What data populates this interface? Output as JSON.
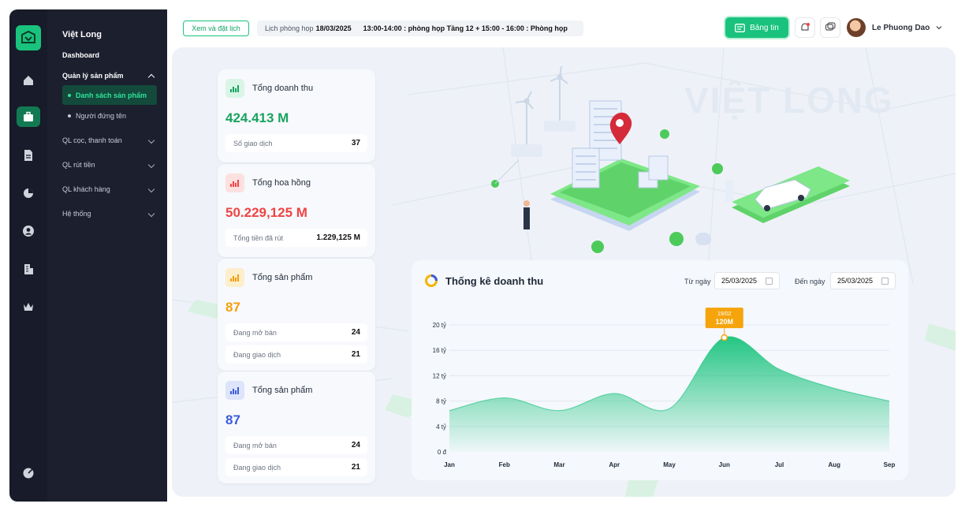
{
  "app": {
    "name": "Việt Long"
  },
  "sidebar": {
    "brand": "Việt Long",
    "dashboard": "Dashboard",
    "group_open": "Quản lý sản phẩm",
    "sub_active": "Danh sách sản phẩm",
    "sub_other": "Người đứng tên",
    "items": [
      "QL cọc, thanh toán",
      "QL rút tiền",
      "QL khách hàng",
      "Hệ thống"
    ]
  },
  "rail_icons": [
    "home-icon",
    "briefcase-icon",
    "document-icon",
    "pie-chart-icon",
    "user-icon",
    "building-icon",
    "crown-icon",
    "settings-chart-icon"
  ],
  "header": {
    "schedule_button": "Xem và đặt lịch",
    "meeting_label": "Lịch phòng họp",
    "meeting_date": "18/03/2025",
    "meeting_detail": "13:00-14:00 : phòng họp Tầng 12 + 15:00 - 16:00 : Phòng họp",
    "news_button": "Bảng tin",
    "user_name": "Le Phuong Dao"
  },
  "watermark": "VIỆT LONG",
  "cards": [
    {
      "title": "Tổng doanh thu",
      "value": "424.413 M",
      "color": "#19a35f",
      "rows": [
        [
          "Số giao dịch",
          "37"
        ]
      ]
    },
    {
      "title": "Tổng hoa hồng",
      "value": "50.229,125 M",
      "color": "#ef4444",
      "rows": [
        [
          "Tổng tiền đã rút",
          "1.229,125 M"
        ]
      ]
    },
    {
      "title": "Tổng sản phẩm",
      "value": "87",
      "color": "#f59e0b",
      "rows": [
        [
          "Đang mở bán",
          "24"
        ],
        [
          "Đang giao dịch",
          "21"
        ]
      ]
    },
    {
      "title": "Tổng sản phẩm",
      "value": "87",
      "color": "#3b5bdb",
      "rows": [
        [
          "Đang mở bán",
          "24"
        ],
        [
          "Đang giao dịch",
          "21"
        ]
      ]
    }
  ],
  "chart_panel": {
    "title": "Thống kê doanh thu",
    "from_label": "Từ ngày",
    "from_value": "25/03/2025",
    "to_label": "Đến ngày",
    "to_value": "25/03/2025"
  },
  "chart_data": {
    "type": "area",
    "categories": [
      "Jan",
      "Feb",
      "Mar",
      "Apr",
      "May",
      "Jun",
      "Jul",
      "Aug",
      "Sep"
    ],
    "values": [
      6.5,
      8.5,
      6.5,
      9.2,
      6.8,
      18.0,
      13.0,
      10.0,
      8.0
    ],
    "y_ticks": [
      "0 đ",
      "4 tỷ",
      "8 tỷ",
      "12 tỷ",
      "16 tỷ",
      "20 tỷ"
    ],
    "ylim": [
      0,
      20
    ],
    "tooltip": {
      "date": "19/02",
      "value": "120M",
      "index": 5
    },
    "color": "#19c37d"
  }
}
